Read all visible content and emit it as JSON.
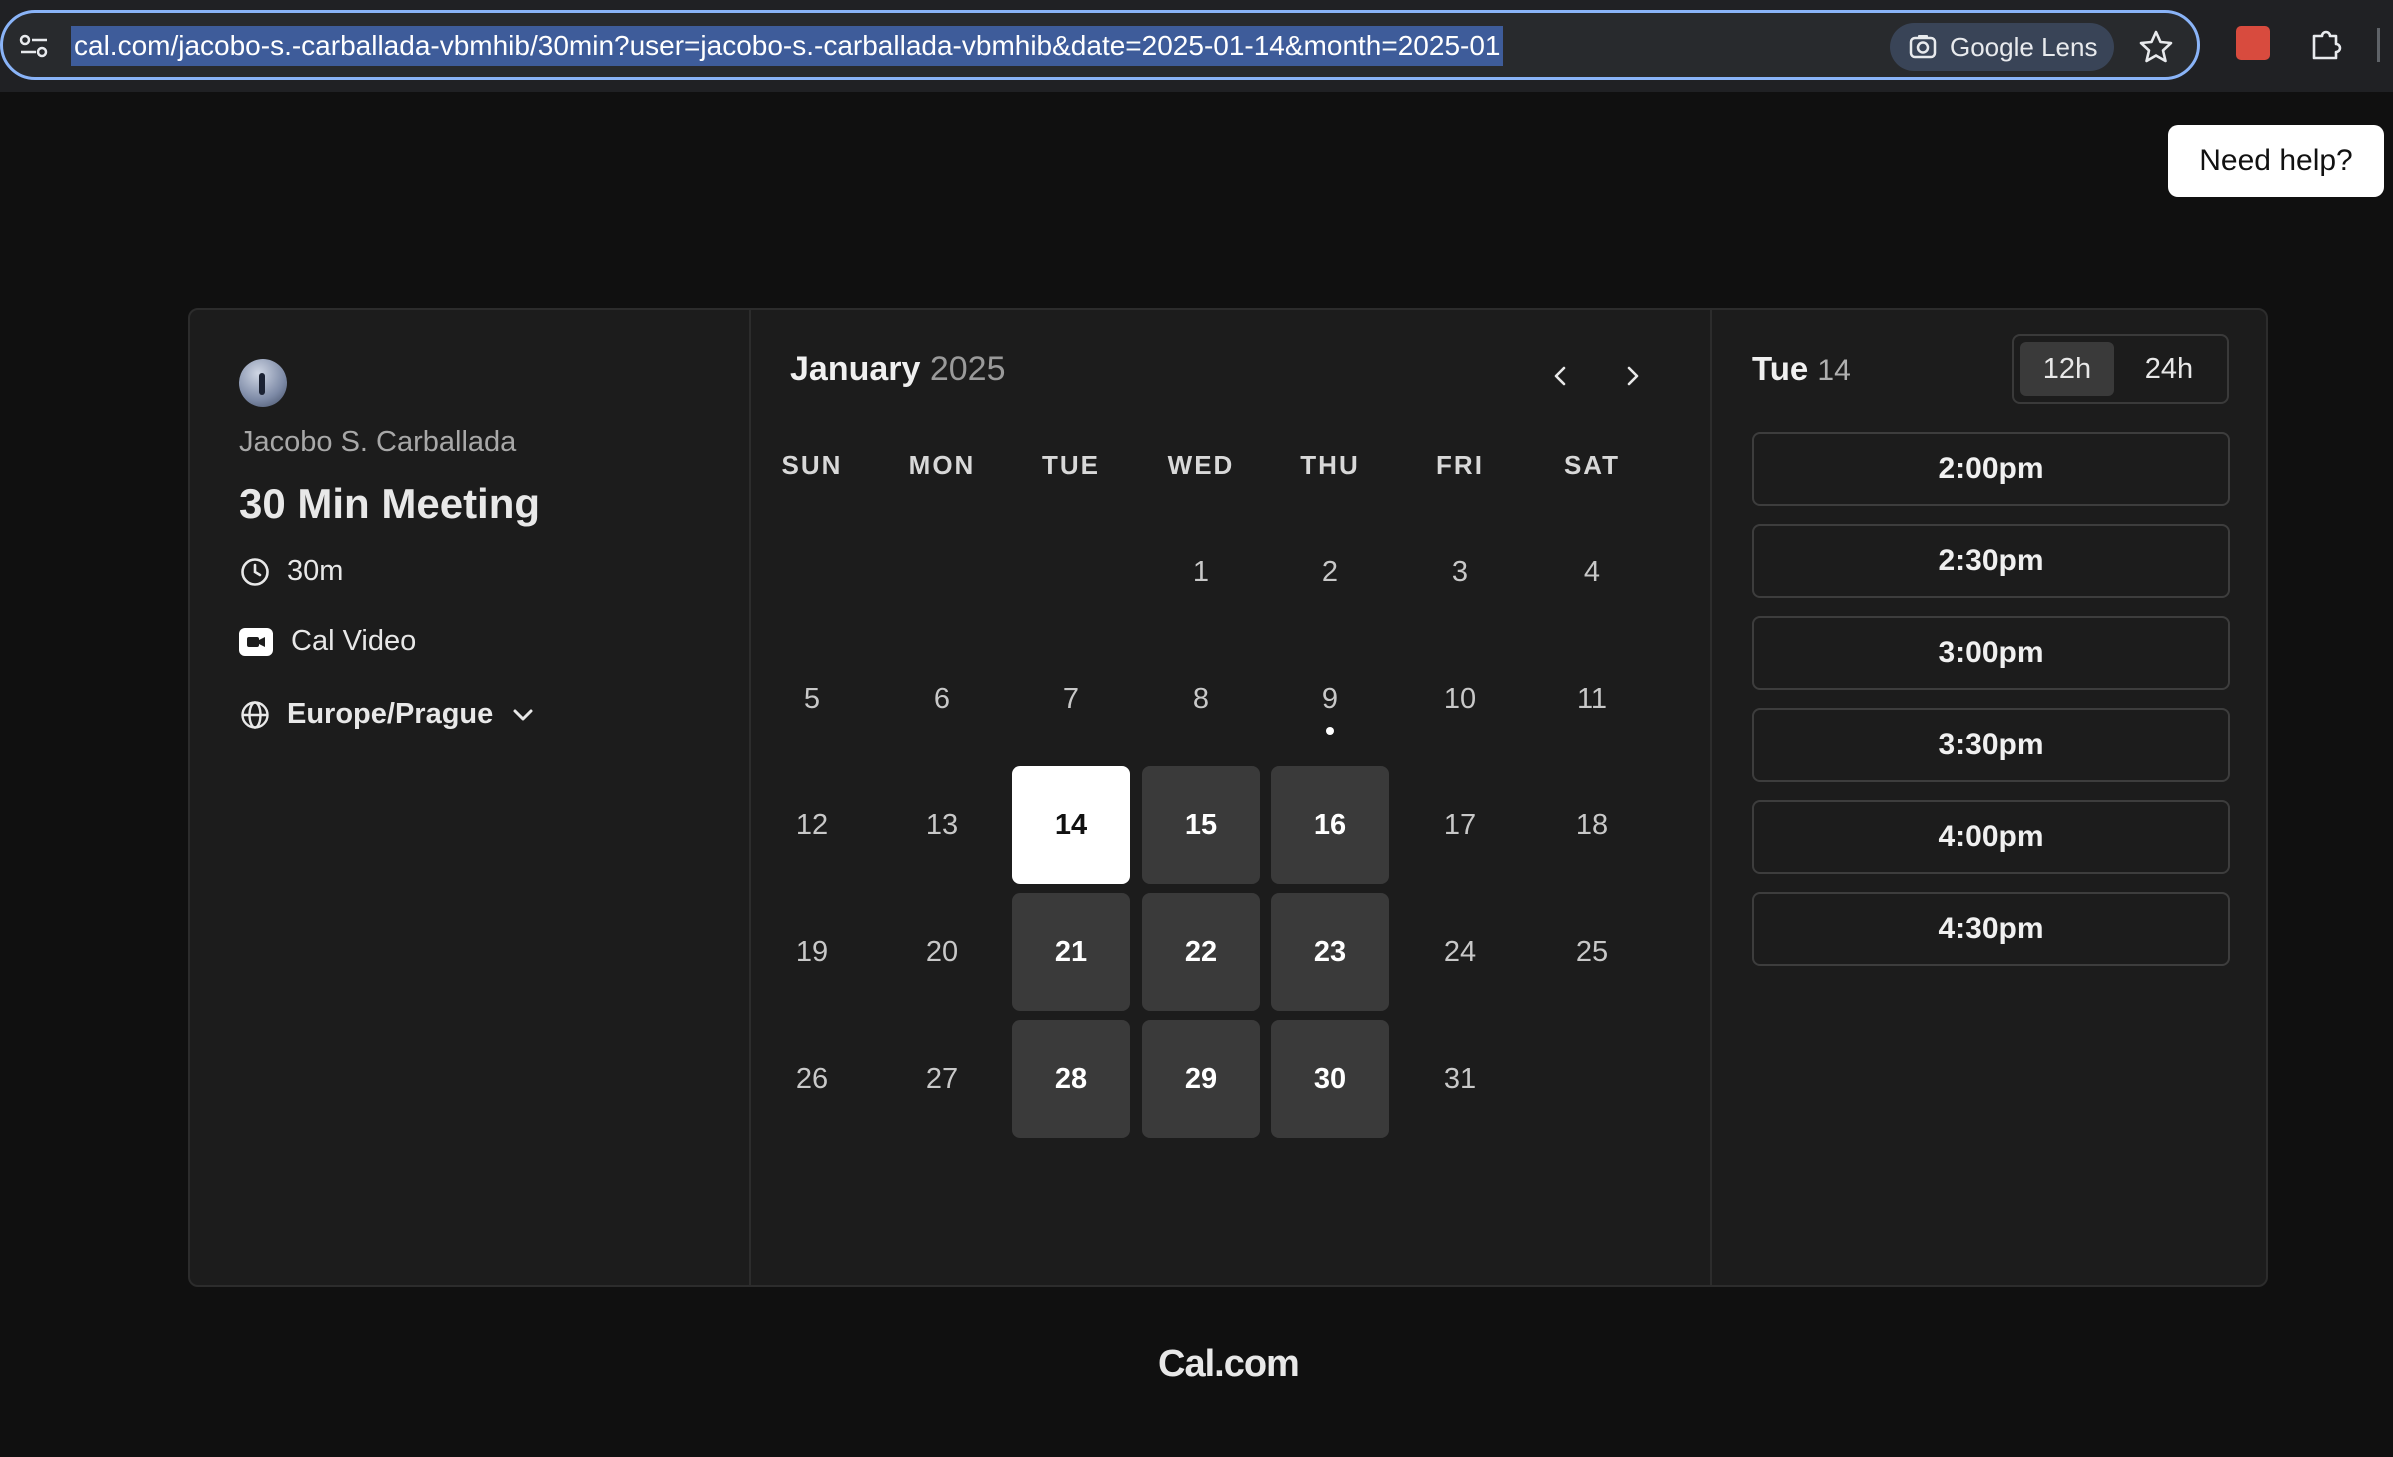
{
  "browser": {
    "url": "cal.com/jacobo-s.-carballada-vbmhib/30min?user=jacobo-s.-carballada-vbmhib&date=2025-01-14&month=2025-01",
    "lens_label": "Google Lens"
  },
  "help_label": "Need help?",
  "event": {
    "host": "Jacobo S. Carballada",
    "title": "30 Min Meeting",
    "duration": "30m",
    "location": "Cal Video",
    "timezone": "Europe/Prague"
  },
  "calendar": {
    "month": "January",
    "year": "2025",
    "weekdays": [
      "SUN",
      "MON",
      "TUE",
      "WED",
      "THU",
      "FRI",
      "SAT"
    ],
    "days": [
      {
        "d": "1",
        "state": "plain"
      },
      {
        "d": "2",
        "state": "plain"
      },
      {
        "d": "3",
        "state": "plain"
      },
      {
        "d": "4",
        "state": "plain"
      },
      {
        "d": "5",
        "state": "plain"
      },
      {
        "d": "6",
        "state": "plain"
      },
      {
        "d": "7",
        "state": "plain"
      },
      {
        "d": "8",
        "state": "plain"
      },
      {
        "d": "9",
        "state": "today"
      },
      {
        "d": "10",
        "state": "plain"
      },
      {
        "d": "11",
        "state": "plain"
      },
      {
        "d": "12",
        "state": "plain"
      },
      {
        "d": "13",
        "state": "plain"
      },
      {
        "d": "14",
        "state": "selected"
      },
      {
        "d": "15",
        "state": "available"
      },
      {
        "d": "16",
        "state": "available"
      },
      {
        "d": "17",
        "state": "plain"
      },
      {
        "d": "18",
        "state": "plain"
      },
      {
        "d": "19",
        "state": "plain"
      },
      {
        "d": "20",
        "state": "plain"
      },
      {
        "d": "21",
        "state": "available"
      },
      {
        "d": "22",
        "state": "available"
      },
      {
        "d": "23",
        "state": "available"
      },
      {
        "d": "24",
        "state": "plain"
      },
      {
        "d": "25",
        "state": "plain"
      },
      {
        "d": "26",
        "state": "plain"
      },
      {
        "d": "27",
        "state": "plain"
      },
      {
        "d": "28",
        "state": "available"
      },
      {
        "d": "29",
        "state": "available"
      },
      {
        "d": "30",
        "state": "available"
      },
      {
        "d": "31",
        "state": "plain"
      }
    ]
  },
  "slots_panel": {
    "day_name": "Tue",
    "day_number": "14",
    "format_12h": "12h",
    "format_24h": "24h",
    "selected_format": "12h",
    "slots": [
      "2:00pm",
      "2:30pm",
      "3:00pm",
      "3:30pm",
      "4:00pm",
      "4:30pm"
    ]
  },
  "footer_brand": "Cal.com"
}
